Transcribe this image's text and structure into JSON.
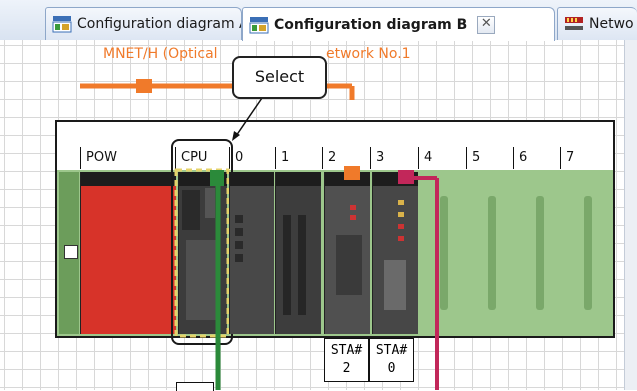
{
  "tabs": [
    {
      "label": "Configuration diagram A",
      "active": false
    },
    {
      "label": "Configuration diagram B",
      "active": true,
      "close": "✕"
    },
    {
      "label": "Netwo",
      "active": false
    }
  ],
  "network": {
    "label_left": "MNET/H (Optical",
    "label_right": "etwork No.1",
    "color": "#f07a2a"
  },
  "callout": {
    "label": "Select"
  },
  "slots": [
    "POW",
    "CPU",
    "0",
    "1",
    "2",
    "3",
    "4",
    "5",
    "6",
    "7"
  ],
  "station_labels": [
    {
      "title": "STA#",
      "num": "2"
    },
    {
      "title": "STA#",
      "num": "0"
    }
  ],
  "colors": {
    "network_orange": "#f07a2a",
    "cable_green": "#2b8a3a",
    "cable_red": "#c2275a",
    "power_red": "#d73329",
    "base_green": "#9dc78c",
    "select_yellow": "#e5d36a"
  }
}
